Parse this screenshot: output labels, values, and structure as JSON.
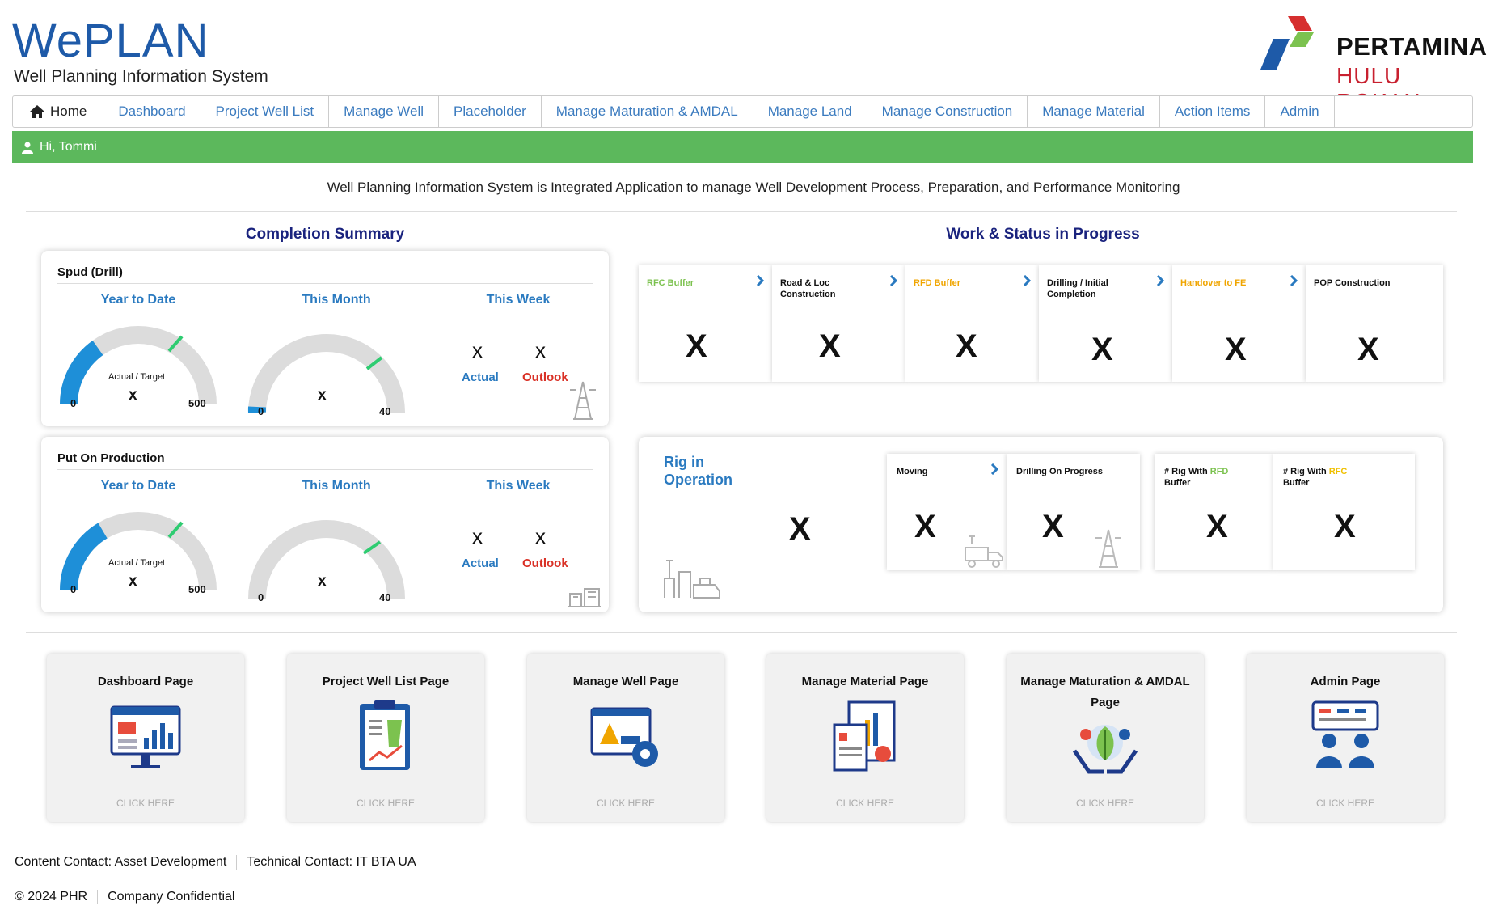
{
  "header": {
    "app_title": "WePLAN",
    "app_subtitle": "Well Planning Information System",
    "logo_line1": "PERTAMINA",
    "logo_line2": "HULU ROKAN"
  },
  "nav": {
    "home": "Home",
    "items": [
      "Dashboard",
      "Project Well List",
      "Manage Well",
      "Placeholder",
      "Manage Maturation & AMDAL",
      "Manage Land",
      "Manage Construction",
      "Manage Material",
      "Action Items",
      "Admin"
    ]
  },
  "greeting": "Hi, Tommi",
  "intro": "Well Planning Information System is Integrated Application to manage Well Development Process, Preparation, and Performance Monitoring",
  "completion": {
    "title": "Completion Summary",
    "spud": {
      "title": "Spud (Drill)",
      "ytd_label": "Year to Date",
      "month_label": "This Month",
      "week_label": "This Week",
      "ytd_caption": "Actual / Target",
      "ytd_value": "x",
      "ytd_min": "0",
      "ytd_max": "500",
      "month_value": "x",
      "month_min": "0",
      "month_max": "40",
      "week_actual": "x",
      "week_outlook": "x",
      "actual_label": "Actual",
      "outlook_label": "Outlook"
    },
    "pop": {
      "title": "Put On Production",
      "ytd_label": "Year to Date",
      "month_label": "This Month",
      "week_label": "This Week",
      "ytd_caption": "Actual / Target",
      "ytd_value": "x",
      "ytd_min": "0",
      "ytd_max": "500",
      "month_value": "x",
      "month_min": "0",
      "month_max": "40",
      "week_actual": "x",
      "week_outlook": "x",
      "actual_label": "Actual",
      "outlook_label": "Outlook"
    }
  },
  "wip": {
    "title": "Work & Status in Progress",
    "cards": [
      {
        "label": "RFC Buffer",
        "value": "X"
      },
      {
        "label": "Road & Loc Construction",
        "value": "X"
      },
      {
        "label": "RFD Buffer",
        "value": "X"
      },
      {
        "label": "Drilling / Initial Completion",
        "value": "X"
      },
      {
        "label": "Handover to FE",
        "value": "X"
      },
      {
        "label": "POP Construction",
        "value": "X"
      }
    ],
    "rig": {
      "title_line1": "Rig in",
      "title_line2": "Operation",
      "value": "X",
      "moving_label": "Moving",
      "moving_value": "X",
      "drilling_label": "Drilling On Progress",
      "drilling_value": "X",
      "rfd_prefix": "# Rig With",
      "rfd_tag": "RFD",
      "rfd_suffix": "Buffer",
      "rfd_value": "X",
      "rfc_prefix": "# Rig With",
      "rfc_tag": "RFC",
      "rfc_suffix": "Buffer",
      "rfc_value": "X"
    }
  },
  "tiles": [
    {
      "title": "Dashboard Page",
      "cta": "CLICK HERE"
    },
    {
      "title": "Project Well List Page",
      "cta": "CLICK HERE"
    },
    {
      "title": "Manage Well Page",
      "cta": "CLICK HERE"
    },
    {
      "title": "Manage Material Page",
      "cta": "CLICK HERE"
    },
    {
      "title": "Manage Maturation & AMDAL Page",
      "cta": "CLICK HERE"
    },
    {
      "title": "Admin Page",
      "cta": "CLICK HERE"
    }
  ],
  "footer": {
    "content_contact": "Content Contact: Asset Development",
    "technical_contact": "Technical Contact: IT BTA UA",
    "copyright": "© 2024 PHR",
    "confidential": "Company Confidential"
  },
  "colors": {
    "brand_blue": "#1e5aa8",
    "greeting_green": "#5cb85c",
    "gauge_fill": "#1e8fd8",
    "gauge_marker": "#2ecc71",
    "outlook_red": "#d93025",
    "rfc_green": "#7cc24f",
    "rfd_orange": "#f0a500"
  }
}
